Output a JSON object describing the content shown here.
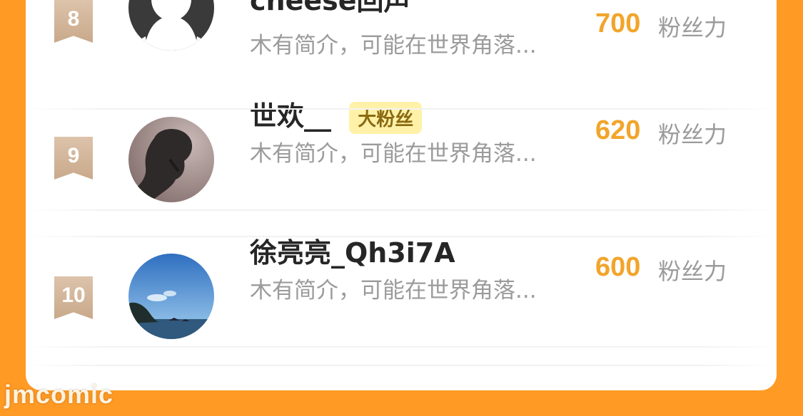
{
  "leaderboard": {
    "rows": [
      {
        "rank": "8",
        "name": "cheese回声",
        "tag": "",
        "desc": "木有简介，可能在世界角落...",
        "score": "700",
        "unit": "粉丝力",
        "avatar_icon": "ghost-avatar-icon"
      },
      {
        "rank": "9",
        "name": "世欢__",
        "tag": "大粉丝",
        "desc": "木有简介，可能在世界角落...",
        "score": "620",
        "unit": "粉丝力",
        "avatar_icon": "photo-avatar"
      },
      {
        "rank": "10",
        "name": "徐亮亮_Qh3i7A",
        "tag": "",
        "desc": "木有简介，可能在世界角落...",
        "score": "600",
        "unit": "粉丝力",
        "avatar_icon": "landscape-avatar"
      }
    ]
  },
  "colors": {
    "background": "#ff9a24",
    "card": "#ffffff",
    "score": "#f2a52b",
    "tag_bg": "#fff2a8",
    "rank_badge": "#d2b598"
  },
  "watermark": "jmcomic"
}
